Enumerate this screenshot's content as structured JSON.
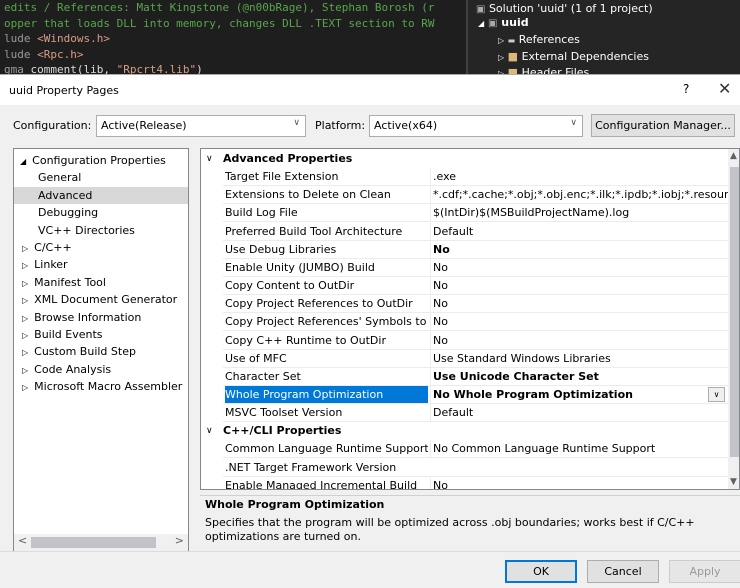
{
  "background_editor": {
    "lines": [
      {
        "segments": [
          {
            "cls": "cm",
            "text": "edits / References: Matt Kingstone (@n00bRage), Stephan Borosh (r"
          }
        ]
      },
      {
        "segments": [
          {
            "cls": "cm",
            "text": "opper that loads DLL into memory, changes DLL .TEXT section to RW"
          }
        ]
      },
      {
        "segments": [
          {
            "cls": "kw",
            "text": "lude "
          },
          {
            "cls": "st",
            "text": "<Windows.h>"
          }
        ]
      },
      {
        "segments": [
          {
            "cls": "kw",
            "text": "lude "
          },
          {
            "cls": "st",
            "text": "<Rpc.h>"
          }
        ]
      },
      {
        "segments": [
          {
            "cls": "kw",
            "text": "gma "
          },
          {
            "cls": "nm",
            "text": "comment(lib, "
          },
          {
            "cls": "st",
            "text": "\"Rpcrt4.lib\""
          },
          {
            "cls": "nm",
            "text": ")"
          }
        ]
      }
    ]
  },
  "background_solution": {
    "solution": "Solution 'uuid' (1 of 1 project)",
    "project": "uuid",
    "references": "References",
    "external": "External Dependencies",
    "header_files": "Header Files"
  },
  "dialog": {
    "title": "uuid Property Pages",
    "help": "?",
    "close": "✕",
    "configuration_label": "Configuration:",
    "configuration_value": "Active(Release)",
    "platform_label": "Platform:",
    "platform_value": "Active(x64)",
    "config_manager": "Configuration Manager...",
    "ok": "OK",
    "cancel": "Cancel",
    "apply": "Apply"
  },
  "tree": {
    "items": [
      {
        "label": "Configuration Properties",
        "level": 0,
        "glyph": "◢",
        "selected": false
      },
      {
        "label": "General",
        "level": 1,
        "glyph": "",
        "selected": false
      },
      {
        "label": "Advanced",
        "level": 1,
        "glyph": "",
        "selected": true
      },
      {
        "label": "Debugging",
        "level": 1,
        "glyph": "",
        "selected": false
      },
      {
        "label": "VC++ Directories",
        "level": 1,
        "glyph": "",
        "selected": false
      },
      {
        "label": "C/C++",
        "level": 0.5,
        "glyph": "▷",
        "selected": false
      },
      {
        "label": "Linker",
        "level": 0.5,
        "glyph": "▷",
        "selected": false
      },
      {
        "label": "Manifest Tool",
        "level": 0.5,
        "glyph": "▷",
        "selected": false
      },
      {
        "label": "XML Document Generator",
        "level": 0.5,
        "glyph": "▷",
        "selected": false
      },
      {
        "label": "Browse Information",
        "level": 0.5,
        "glyph": "▷",
        "selected": false
      },
      {
        "label": "Build Events",
        "level": 0.5,
        "glyph": "▷",
        "selected": false
      },
      {
        "label": "Custom Build Step",
        "level": 0.5,
        "glyph": "▷",
        "selected": false
      },
      {
        "label": "Code Analysis",
        "level": 0.5,
        "glyph": "▷",
        "selected": false
      },
      {
        "label": "Microsoft Macro Assembler",
        "level": 0.5,
        "glyph": "▷",
        "selected": false
      }
    ]
  },
  "grid": {
    "sections": [
      {
        "title": "Advanced Properties",
        "rows": [
          {
            "name": "Target File Extension",
            "value": ".exe",
            "bold": false
          },
          {
            "name": "Extensions to Delete on Clean",
            "value": "*.cdf;*.cache;*.obj;*.obj.enc;*.ilk;*.ipdb;*.iobj;*.resources;*.t",
            "bold": false
          },
          {
            "name": "Build Log File",
            "value": "$(IntDir)$(MSBuildProjectName).log",
            "bold": false
          },
          {
            "name": "Preferred Build Tool Architecture",
            "value": "Default",
            "bold": false
          },
          {
            "name": "Use Debug Libraries",
            "value": "No",
            "bold": true
          },
          {
            "name": "Enable Unity (JUMBO) Build",
            "value": "No",
            "bold": false
          },
          {
            "name": "Copy Content to OutDir",
            "value": "No",
            "bold": false
          },
          {
            "name": "Copy Project References to OutDir",
            "value": "No",
            "bold": false
          },
          {
            "name": "Copy Project References' Symbols to OutDir",
            "value": "No",
            "bold": false
          },
          {
            "name": "Copy C++ Runtime to OutDir",
            "value": "No",
            "bold": false
          },
          {
            "name": "Use of MFC",
            "value": "Use Standard Windows Libraries",
            "bold": false
          },
          {
            "name": "Character Set",
            "value": "Use Unicode Character Set",
            "bold": true
          },
          {
            "name": "Whole Program Optimization",
            "value": "No Whole Program Optimization",
            "bold": true,
            "selected": true
          },
          {
            "name": "MSVC Toolset Version",
            "value": "Default",
            "bold": false
          }
        ]
      },
      {
        "title": "C++/CLI Properties",
        "rows": [
          {
            "name": "Common Language Runtime Support",
            "value": "No Common Language Runtime Support",
            "bold": false
          },
          {
            "name": ".NET Target Framework Version",
            "value": "",
            "bold": false
          },
          {
            "name": "Enable Managed Incremental Build",
            "value": "No",
            "bold": false
          }
        ]
      }
    ]
  },
  "description": {
    "title": "Whole Program Optimization",
    "text": "Specifies that the program will be optimized across .obj boundaries; works best if C/C++ optimizations are turned on."
  },
  "icons": {
    "chevron_down": "∨",
    "scroll_up": "▲",
    "scroll_down": "▼",
    "scroll_left": "<",
    "scroll_right": ">",
    "dropdown": "∨"
  }
}
